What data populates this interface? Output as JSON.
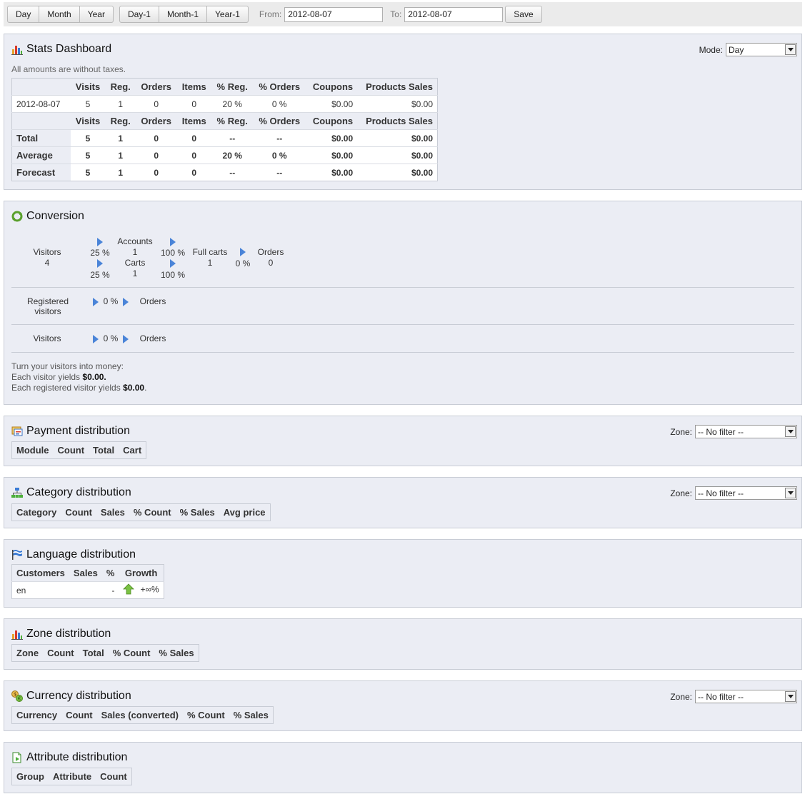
{
  "toolbar": {
    "period_buttons": [
      "Day",
      "Month",
      "Year"
    ],
    "relative_buttons": [
      "Day-1",
      "Month-1",
      "Year-1"
    ],
    "from_label": "From:",
    "from_value": "2012-08-07",
    "to_label": "To:",
    "to_value": "2012-08-07",
    "save_label": "Save"
  },
  "stats": {
    "title": "Stats Dashboard",
    "mode_label": "Mode:",
    "mode_value": "Day",
    "note": "All amounts are without taxes.",
    "headers": [
      "Visits",
      "Reg.",
      "Orders",
      "Items",
      "% Reg.",
      "% Orders",
      "Coupons",
      "Products Sales"
    ],
    "date_row": {
      "label": "2012-08-07",
      "cells": [
        "5",
        "1",
        "0",
        "0",
        "20 %",
        "0 %",
        "$0.00",
        "$0.00"
      ]
    },
    "summary_rows": [
      {
        "label": "Total",
        "cells": [
          "5",
          "1",
          "0",
          "0",
          "--",
          "--",
          "$0.00",
          "$0.00"
        ]
      },
      {
        "label": "Average",
        "cells": [
          "5",
          "1",
          "0",
          "0",
          "20 %",
          "0 %",
          "$0.00",
          "$0.00"
        ]
      },
      {
        "label": "Forecast",
        "cells": [
          "5",
          "1",
          "0",
          "0",
          "--",
          "--",
          "$0.00",
          "$0.00"
        ]
      }
    ]
  },
  "conversion": {
    "title": "Conversion",
    "visitors_label": "Visitors",
    "visitors_value": "4",
    "pct_accounts": "25 %",
    "pct_carts": "25 %",
    "accounts_label": "Accounts",
    "accounts_value": "1",
    "carts_label": "Carts",
    "carts_value": "1",
    "pct_accounts_full": "100 %",
    "pct_carts_full": "100 %",
    "fullcarts_label": "Full carts",
    "fullcarts_value": "1",
    "pct_orders": "0 %",
    "orders_label": "Orders",
    "orders_value": "0",
    "registered_label_1": "Registered",
    "registered_label_2": "visitors",
    "registered_pct": "0 %",
    "registered_orders": "Orders",
    "visitors2_label": "Visitors",
    "visitors2_pct": "0 %",
    "visitors2_orders": "Orders",
    "money_line1": "Turn your visitors into money:",
    "money_line2": "Each visitor yields",
    "money_value2": "$0.00.",
    "money_line3": "Each registered visitor yields",
    "money_value3": "$0.00",
    "money_end3": "."
  },
  "payment": {
    "title": "Payment distribution",
    "zone_label": "Zone:",
    "zone_value": "-- No filter --",
    "headers": [
      "Module",
      "Count",
      "Total",
      "Cart"
    ]
  },
  "category": {
    "title": "Category distribution",
    "zone_label": "Zone:",
    "zone_value": "-- No filter --",
    "headers": [
      "Category",
      "Count",
      "Sales",
      "% Count",
      "% Sales",
      "Avg price"
    ]
  },
  "language": {
    "title": "Language distribution",
    "headers": [
      "Customers",
      "Sales",
      "%",
      "Growth"
    ],
    "row": {
      "customers": "en",
      "sales": "",
      "pct": "-",
      "growth": "+∞%"
    }
  },
  "zone": {
    "title": "Zone distribution",
    "headers": [
      "Zone",
      "Count",
      "Total",
      "% Count",
      "% Sales"
    ]
  },
  "currency": {
    "title": "Currency distribution",
    "zone_label": "Zone:",
    "zone_value": "-- No filter --",
    "headers": [
      "Currency",
      "Count",
      "Sales (converted)",
      "% Count",
      "% Sales"
    ]
  },
  "attribute": {
    "title": "Attribute distribution",
    "headers": [
      "Group",
      "Attribute",
      "Count"
    ]
  },
  "colors": {
    "panel_bg": "#ebedf4",
    "panel_border": "#c8ccd5",
    "arrow_blue": "#4a84d8",
    "growth_green": "#7ac143"
  },
  "icons": [
    "bar-chart-icon",
    "conversion-icon",
    "payment-icon",
    "category-icon",
    "flag-icon",
    "currency-icon",
    "attribute-icon",
    "growth-up-arrow-icon",
    "triangle-right-icon"
  ]
}
